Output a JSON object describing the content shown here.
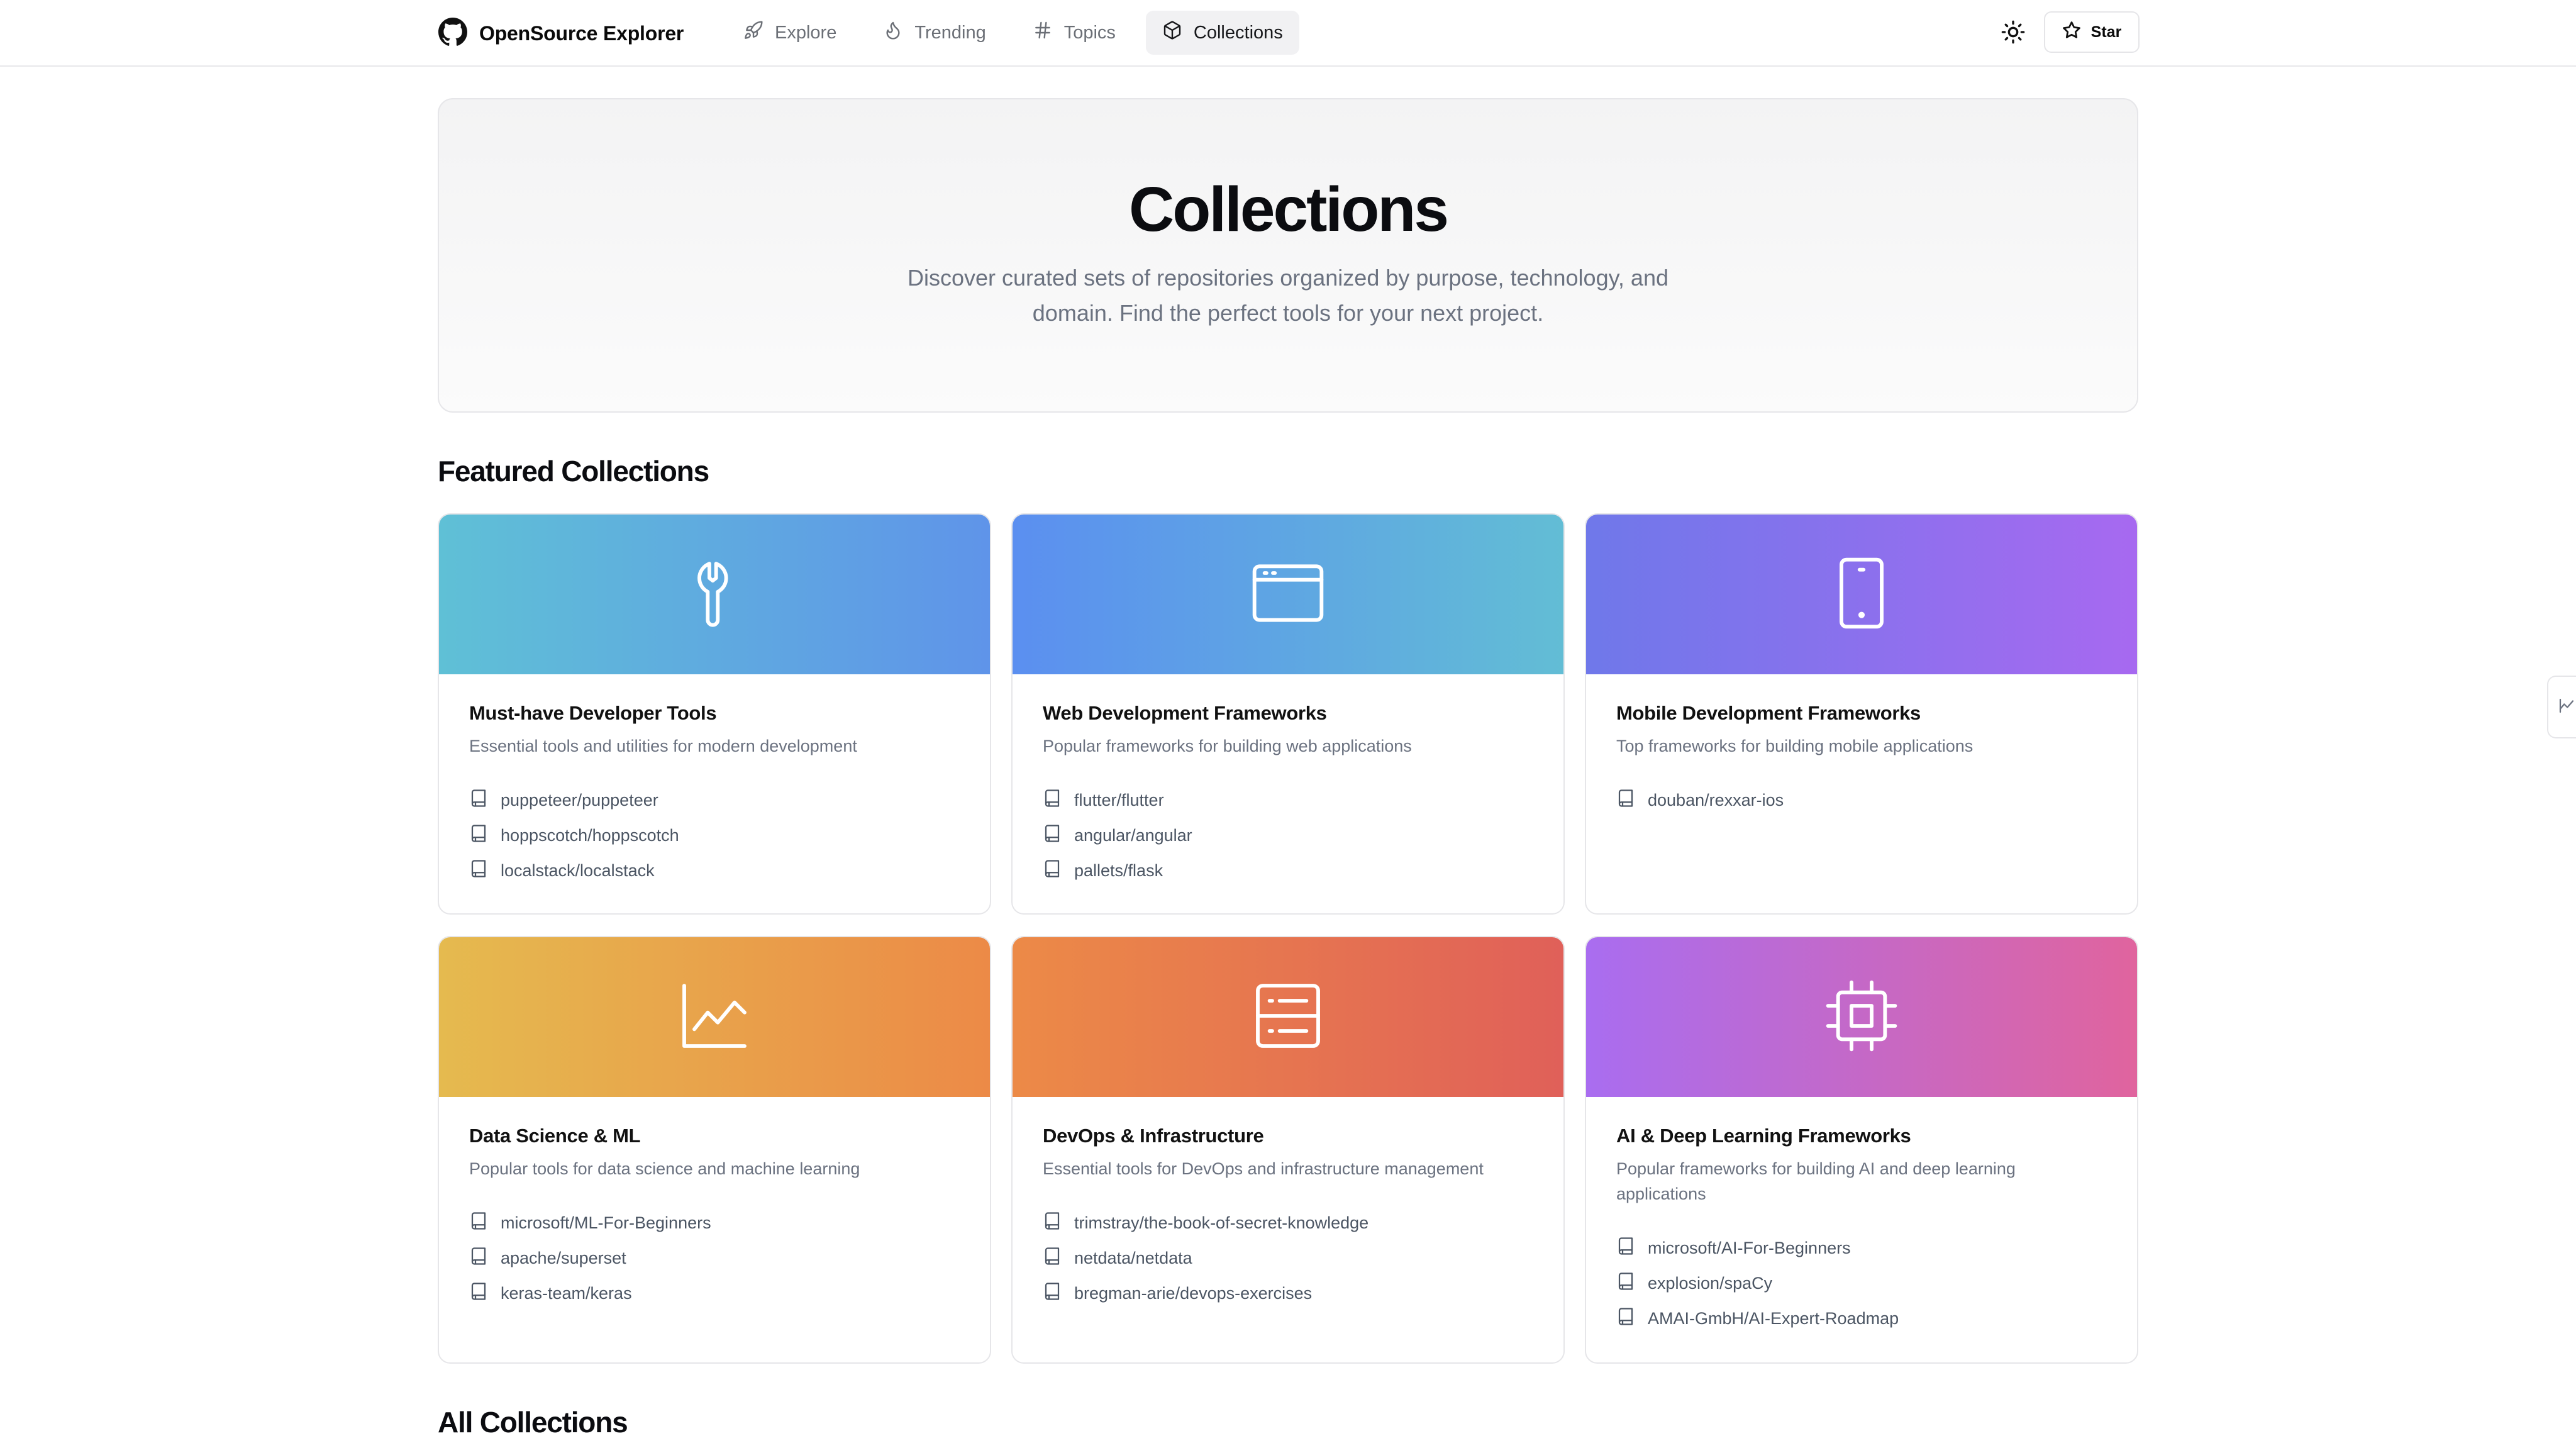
{
  "brand": {
    "name": "OpenSource Explorer",
    "icon": "github-icon"
  },
  "nav": [
    {
      "label": "Explore",
      "icon": "rocket-icon",
      "active": false
    },
    {
      "label": "Trending",
      "icon": "flame-icon",
      "active": false
    },
    {
      "label": "Topics",
      "icon": "hash-icon",
      "active": false
    },
    {
      "label": "Collections",
      "icon": "box-icon",
      "active": true
    }
  ],
  "header_actions": {
    "theme_icon": "sun-icon",
    "star_label": "Star"
  },
  "hero": {
    "title": "Collections",
    "subtitle": "Discover curated sets of repositories organized by purpose, technology, and domain. Find the perfect tools for your next project."
  },
  "featured_title": "Featured Collections",
  "all_title": "All Collections",
  "colors": {
    "accent_active_nav": "#f1f1f3",
    "border": "#e6e6e9",
    "muted_text": "#6b7280"
  },
  "collections": [
    {
      "title": "Must-have Developer Tools",
      "description": "Essential tools and utilities for modern development",
      "icon": "wrench-icon",
      "gradient": [
        "#5fc0d6",
        "#5f94e9"
      ],
      "repos": [
        "puppeteer/puppeteer",
        "hoppscotch/hoppscotch",
        "localstack/localstack"
      ]
    },
    {
      "title": "Web Development Frameworks",
      "description": "Popular frameworks for building web applications",
      "icon": "browser-window-icon",
      "gradient": [
        "#5b8ff0",
        "#62bdd5"
      ],
      "repos": [
        "flutter/flutter",
        "angular/angular",
        "pallets/flask"
      ]
    },
    {
      "title": "Mobile Development Frameworks",
      "description": "Top frameworks for building mobile applications",
      "icon": "smartphone-icon",
      "gradient": [
        "#6f78ea",
        "#a769f0"
      ],
      "repos": [
        "douban/rexxar-ios"
      ]
    },
    {
      "title": "Data Science & ML",
      "description": "Popular tools for data science and machine learning",
      "icon": "line-chart-icon",
      "gradient": [
        "#e5ba4f",
        "#ec8a47"
      ],
      "repos": [
        "microsoft/ML-For-Beginners",
        "apache/superset",
        "keras-team/keras"
      ]
    },
    {
      "title": "DevOps & Infrastructure",
      "description": "Essential tools for DevOps and infrastructure management",
      "icon": "server-icon",
      "gradient": [
        "#ec8a47",
        "#e06059"
      ],
      "repos": [
        "trimstray/the-book-of-secret-knowledge",
        "netdata/netdata",
        "bregman-arie/devops-exercises"
      ]
    },
    {
      "title": "AI & Deep Learning Frameworks",
      "description": "Popular frameworks for building AI and deep learning applications",
      "icon": "cpu-chip-icon",
      "gradient": [
        "#a96df0",
        "#e0649e"
      ],
      "repos": [
        "microsoft/AI-For-Beginners",
        "explosion/spaCy",
        "AMAI-GmbH/AI-Expert-Roadmap"
      ]
    }
  ]
}
